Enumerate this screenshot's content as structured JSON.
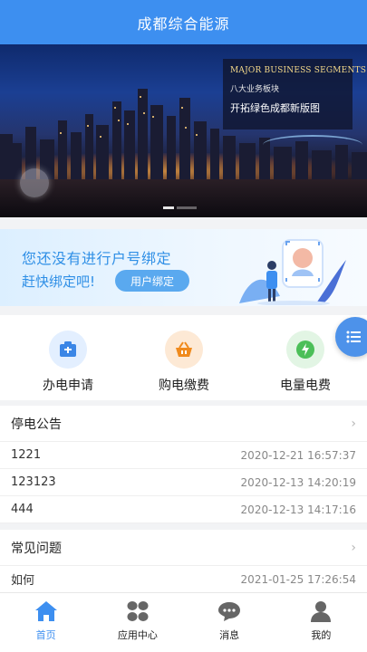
{
  "header": {
    "title": "成都综合能源"
  },
  "banner": {
    "card_en": "MAJOR BUSINESS SEGMENTS",
    "card_cn_small": "八大业务板块",
    "card_cn_large": "开拓绿色成都新版图"
  },
  "bind_banner": {
    "line1": "您还没有进行户号绑定",
    "line2": "赶快绑定吧!",
    "button": "用户绑定"
  },
  "quick_actions": [
    {
      "label": "办电申请",
      "icon": "application-icon",
      "color": "#3b86e6"
    },
    {
      "label": "购电缴费",
      "icon": "basket-icon",
      "color": "#f08a1c"
    },
    {
      "label": "电量电费",
      "icon": "lightning-icon",
      "color": "#4bbf58"
    }
  ],
  "outage_notice": {
    "title": "停电公告",
    "rows": [
      {
        "name": "1221",
        "time": "2020-12-21 16:57:37"
      },
      {
        "name": "123123",
        "time": "2020-12-13 14:20:19"
      },
      {
        "name": "444",
        "time": "2020-12-13 14:17:16"
      }
    ]
  },
  "faq": {
    "title": "常见问题",
    "rows": [
      {
        "name": "如何",
        "time": "2021-01-25 17:26:54"
      }
    ]
  },
  "tabbar": [
    {
      "label": "首页",
      "icon": "home-icon",
      "active": true
    },
    {
      "label": "应用中心",
      "icon": "apps-icon",
      "active": false
    },
    {
      "label": "消息",
      "icon": "message-icon",
      "active": false
    },
    {
      "label": "我的",
      "icon": "user-icon",
      "active": false
    }
  ],
  "colors": {
    "primary": "#3d8ff0",
    "link": "#2f8fe6"
  }
}
